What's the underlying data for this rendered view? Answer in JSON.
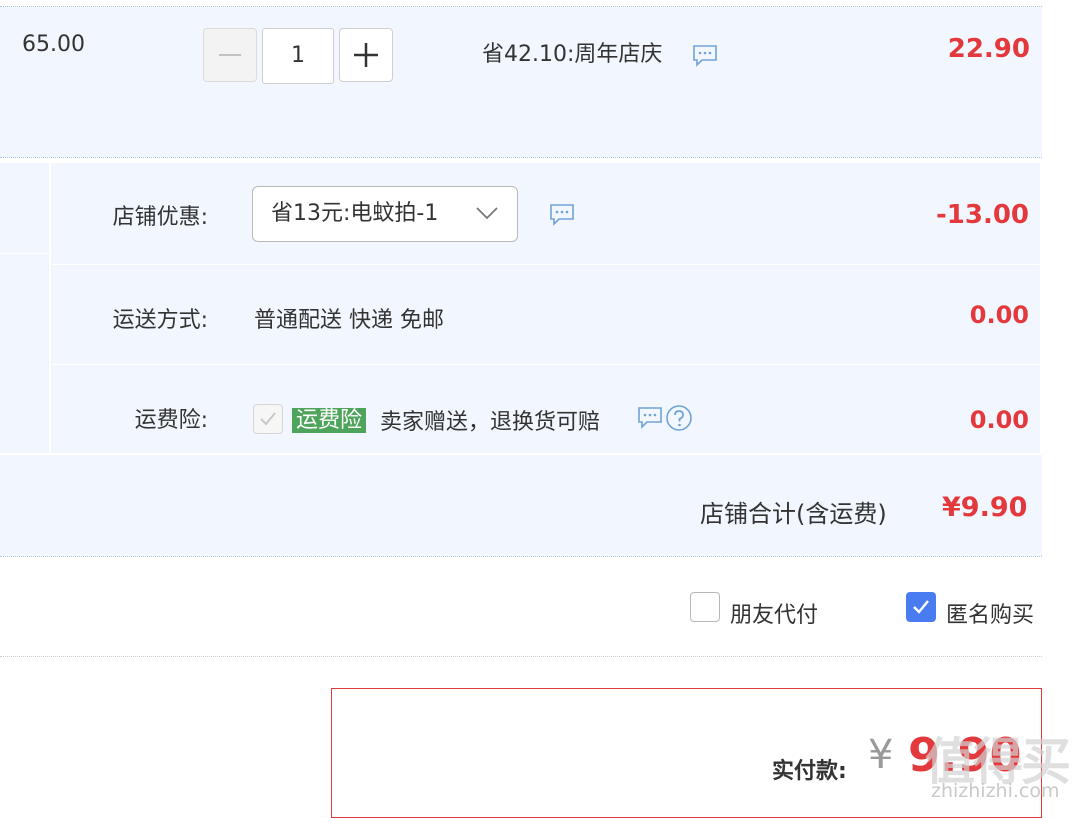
{
  "item": {
    "unit_price": "65.00",
    "quantity": "1",
    "promo_text": "省42.10:周年店庆",
    "subtotal": "22.90"
  },
  "shop_discount": {
    "label": "店铺优惠:",
    "selected": "省13元:电蚊拍-1",
    "amount": "-13.00"
  },
  "shipping": {
    "label": "运送方式:",
    "method": "普通配送 快递 免邮",
    "amount": "0.00"
  },
  "shipping_insurance": {
    "label": "运费险:",
    "tag": "运费险",
    "desc": "卖家赠送，退换货可赔",
    "amount": "0.00"
  },
  "shop_total": {
    "label": "店铺合计(含运费)",
    "value": "¥9.90"
  },
  "options": {
    "friend_pay": "朋友代付",
    "anonymous": "匿名购买"
  },
  "payment": {
    "label": "实付款:",
    "currency": "¥",
    "value": "9.90"
  },
  "watermark": {
    "logo": "值得买",
    "url": "zhizhizhi.com"
  },
  "colors": {
    "accent_red": "#e4393c",
    "checkbox_blue": "#4a7cf1",
    "section_bg": "#f2f7ff",
    "tag_green": "#4fa45c"
  },
  "icons": [
    "minus-icon",
    "plus-icon",
    "chat-bubble-icon",
    "chevron-down-icon",
    "checkmark-icon",
    "question-circle-icon"
  ]
}
